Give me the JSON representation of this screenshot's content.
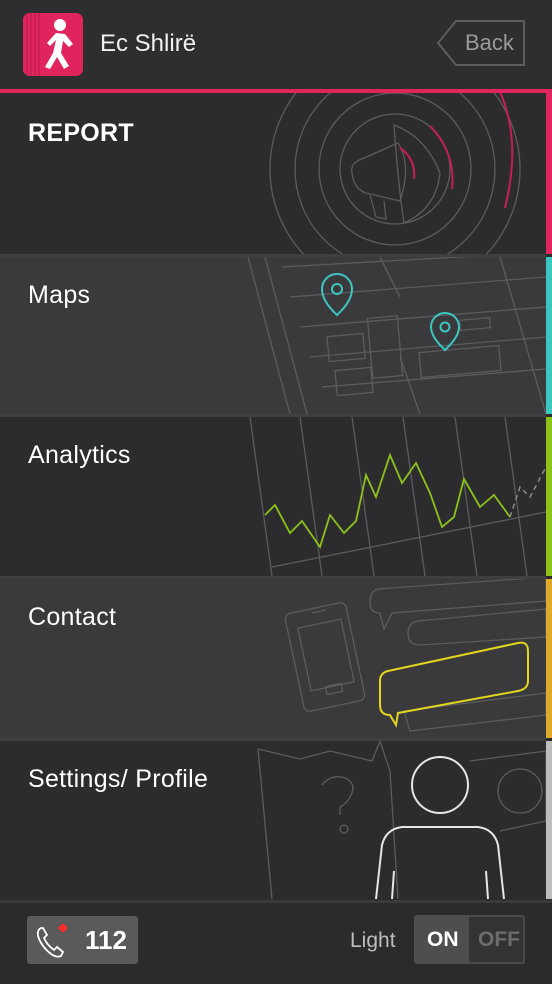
{
  "header": {
    "app_title": "Ec Shlirë",
    "back_label": "Back",
    "accent_color": "#e0245e"
  },
  "menu": {
    "items": [
      {
        "label": "REPORT",
        "icon": "megaphone-icon",
        "color": "#e0245e"
      },
      {
        "label": "Maps",
        "icon": "map-pin-icon",
        "color": "#3cc6c0"
      },
      {
        "label": "Analytics",
        "icon": "line-chart-icon",
        "color": "#8cc21a"
      },
      {
        "label": "Contact",
        "icon": "chat-bubble-icon",
        "color": "#e0a929"
      },
      {
        "label": "Settings/ Profile",
        "icon": "user-profile-icon",
        "color": "#bdbdbd"
      }
    ]
  },
  "footer": {
    "emergency_number": "112",
    "light_label": "Light",
    "toggle_on": "ON",
    "toggle_off": "OFF",
    "light_state": "ON"
  }
}
